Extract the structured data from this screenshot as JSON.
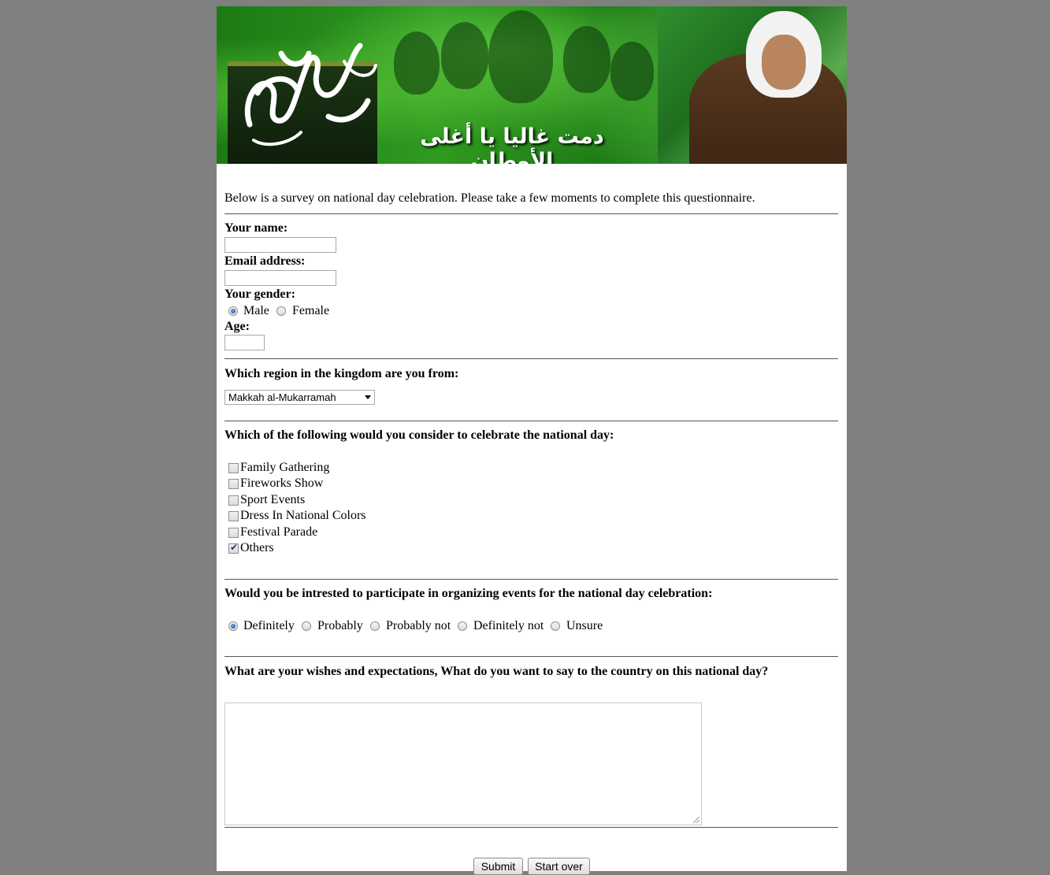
{
  "banner": {
    "calligraphy": "اليوم الوطني",
    "tagline": "دمت غاليا يا أغلى الأوطان"
  },
  "intro": "Below is a survey on national day celebration. Please take a few moments to complete this questionnaire.",
  "fields": {
    "name_label": "Your name:",
    "email_label": "Email address:",
    "gender_label": "Your gender:",
    "gender_options": [
      {
        "label": "Male",
        "checked": true
      },
      {
        "label": "Female",
        "checked": false
      }
    ],
    "age_label": "Age:"
  },
  "region": {
    "label": "Which region in the kingdom are you from:",
    "selected": "Makkah al-Mukarramah"
  },
  "celebrate": {
    "label": "Which of the following would you consider to celebrate the national day:",
    "options": [
      {
        "label": "Family Gathering",
        "checked": false
      },
      {
        "label": "Fireworks Show",
        "checked": false
      },
      {
        "label": "Sport Events",
        "checked": false
      },
      {
        "label": "Dress In National Colors",
        "checked": false
      },
      {
        "label": "Festival Parade",
        "checked": false
      },
      {
        "label": "Others",
        "checked": true
      }
    ]
  },
  "participate": {
    "label": "Would you be intrested to participate in organizing events for the national day celebration:",
    "options": [
      {
        "label": "Definitely",
        "checked": true
      },
      {
        "label": "Probably",
        "checked": false
      },
      {
        "label": "Probably not",
        "checked": false
      },
      {
        "label": "Definitely not",
        "checked": false
      },
      {
        "label": "Unsure",
        "checked": false
      }
    ]
  },
  "wishes": {
    "label": "What are your wishes and expectations, What do you want to say to the country on this national day?"
  },
  "buttons": {
    "submit": "Submit",
    "reset": "Start over"
  }
}
